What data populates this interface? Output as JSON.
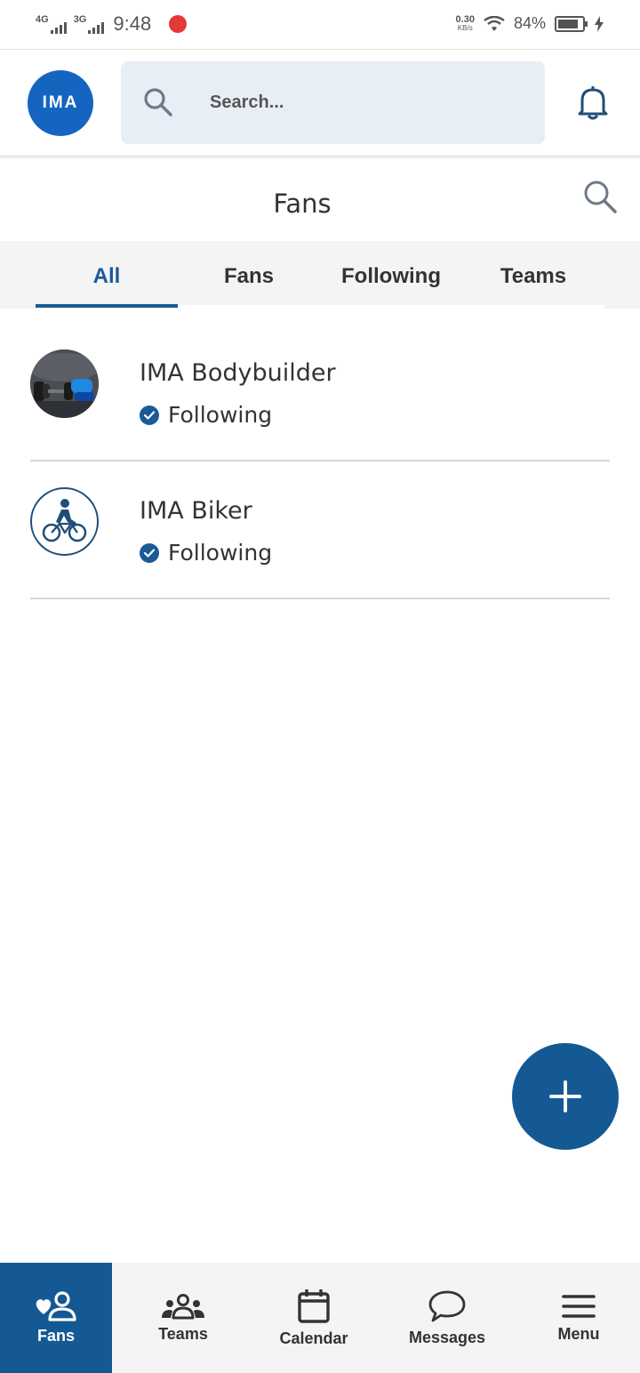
{
  "status_bar": {
    "net1": "4G",
    "net2": "3G",
    "time": "9:48",
    "speed_value": "0.30",
    "speed_unit": "KB/s",
    "battery": "84%",
    "battery_level": 0.84
  },
  "header": {
    "logo_text": "IMA",
    "search_placeholder": "Search..."
  },
  "page": {
    "title": "Fans"
  },
  "tabs": [
    {
      "label": "All",
      "active": true
    },
    {
      "label": "Fans",
      "active": false
    },
    {
      "label": "Following",
      "active": false
    },
    {
      "label": "Teams",
      "active": false
    }
  ],
  "items": [
    {
      "name": "IMA Bodybuilder",
      "status": "Following",
      "avatar": "dumbbell-photo"
    },
    {
      "name": "IMA Biker",
      "status": "Following",
      "avatar": "cyclist-icon"
    }
  ],
  "bottom_nav": [
    {
      "label": "Fans",
      "icon": "fans-icon",
      "active": true
    },
    {
      "label": "Teams",
      "icon": "teams-icon",
      "active": false
    },
    {
      "label": "Calendar",
      "icon": "calendar-icon",
      "active": false
    },
    {
      "label": "Messages",
      "icon": "messages-icon",
      "active": false
    },
    {
      "label": "Menu",
      "icon": "menu-icon",
      "active": false
    }
  ],
  "colors": {
    "primary": "#145993",
    "logo": "#1565c0",
    "search_bg": "#e8eef6"
  }
}
